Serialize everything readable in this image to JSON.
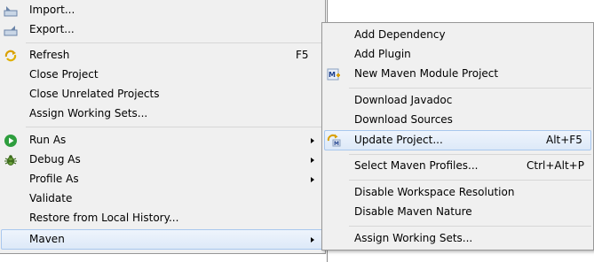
{
  "main_menu": {
    "items": [
      {
        "label": "Import...",
        "icon": "import-icon"
      },
      {
        "label": "Export...",
        "icon": "export-icon"
      },
      {
        "label": "Refresh",
        "accel": "F5",
        "icon": "refresh-icon"
      },
      {
        "label": "Close Project"
      },
      {
        "label": "Close Unrelated Projects"
      },
      {
        "label": "Assign Working Sets..."
      },
      {
        "label": "Run As",
        "icon": "run-icon",
        "submenu": true
      },
      {
        "label": "Debug As",
        "icon": "debug-icon",
        "submenu": true
      },
      {
        "label": "Profile As",
        "submenu": true
      },
      {
        "label": "Validate"
      },
      {
        "label": "Restore from Local History..."
      },
      {
        "label": "Maven",
        "submenu": true,
        "highlighted": true
      }
    ]
  },
  "maven_submenu": {
    "items": [
      {
        "label": "Add Dependency"
      },
      {
        "label": "Add Plugin"
      },
      {
        "label": "New Maven Module Project",
        "icon": "maven-module-icon"
      },
      {
        "label": "Download Javadoc"
      },
      {
        "label": "Download Sources"
      },
      {
        "label": "Update Project...",
        "accel": "Alt+F5",
        "icon": "update-project-icon",
        "highlighted": true
      },
      {
        "label": "Select Maven Profiles...",
        "accel": "Ctrl+Alt+P"
      },
      {
        "label": "Disable Workspace Resolution"
      },
      {
        "label": "Disable Maven Nature"
      },
      {
        "label": "Assign Working Sets..."
      }
    ]
  },
  "colors": {
    "menu_bg": "#f0f0f0",
    "highlight_bg": "#dde9f8",
    "highlight_border": "#a8c7ee",
    "run_icon": "#2e9e3e",
    "debug_icon": "#4a7a2a"
  }
}
